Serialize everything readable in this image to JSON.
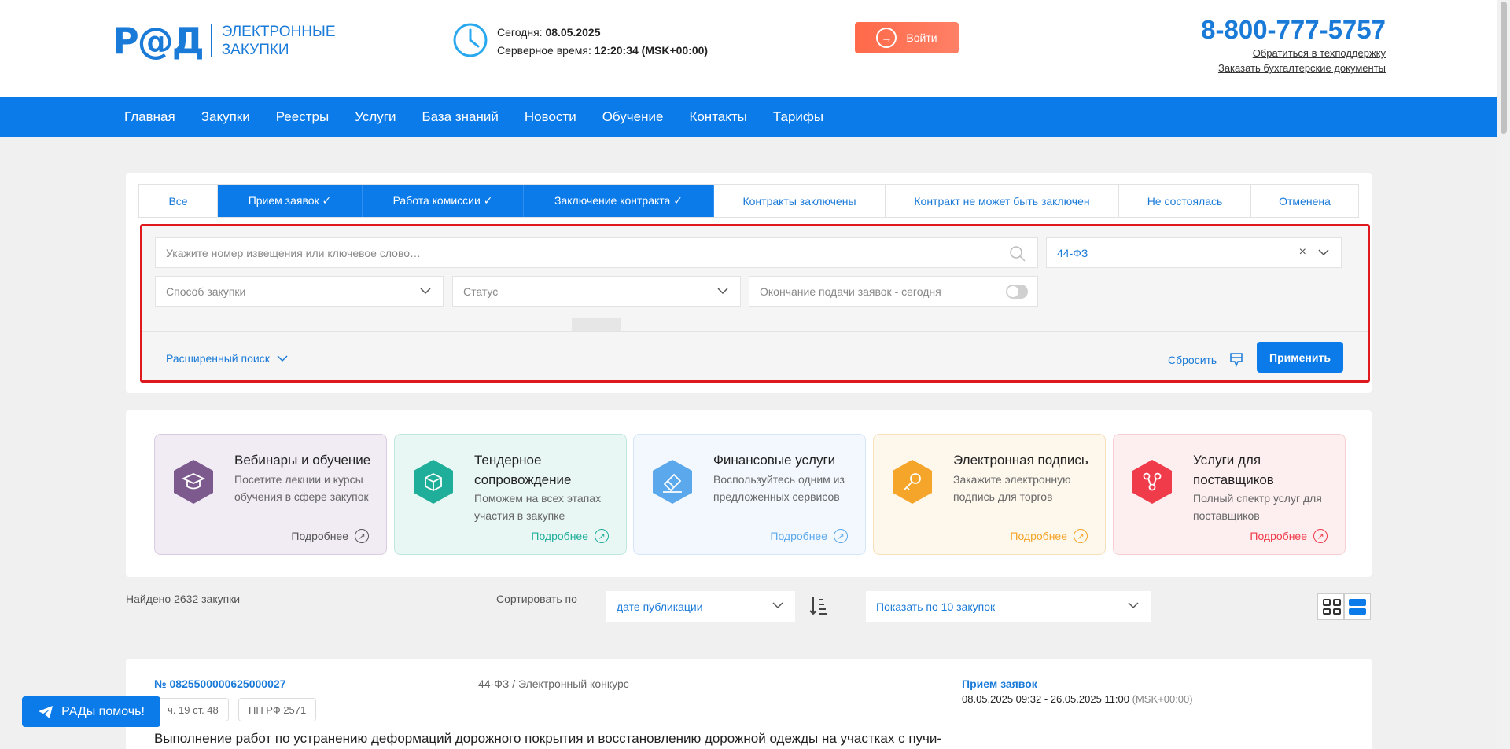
{
  "header": {
    "logo_mark": "Р@Д",
    "logo_line1": "ЭЛЕКТРОННЫЕ",
    "logo_line2": "ЗАКУПКИ",
    "today_label": "Сегодня: ",
    "today_value": "08.05.2025",
    "server_label": "Серверное время: ",
    "server_value": "12:20:34 (MSK+00:00)",
    "login_label": "Войти",
    "phone": "8-800-777-5757",
    "support_link": "Обратиться в техподдержку",
    "docs_link": "Заказать бухгалтерские документы"
  },
  "nav": {
    "items": [
      "Главная",
      "Закупки",
      "Реестры",
      "Услуги",
      "База знаний",
      "Новости",
      "Обучение",
      "Контакты",
      "Тарифы"
    ]
  },
  "tabs": [
    {
      "label": "Все",
      "active": false
    },
    {
      "label": "Прием заявок ✓",
      "active": true
    },
    {
      "label": "Работа комиссии ✓",
      "active": true
    },
    {
      "label": "Заключение контракта ✓",
      "active": true
    },
    {
      "label": "Контракты заключены",
      "active": false
    },
    {
      "label": "Контракт не может быть заключен",
      "active": false
    },
    {
      "label": "Не состоялась",
      "active": false
    },
    {
      "label": "Отменена",
      "active": false
    }
  ],
  "filters": {
    "search_placeholder": "Укажите номер извещения или ключевое слово…",
    "law_value": "44-ФЗ",
    "method_placeholder": "Способ закупки",
    "status_placeholder": "Статус",
    "deadline_toggle_label": "Окончание подачи заявок - сегодня",
    "deadline_toggle_on": false,
    "advanced_label": "Расширенный поиск",
    "reset_label": "Сбросить",
    "apply_label": "Применить"
  },
  "services": [
    {
      "title": "Вебинары и обучение",
      "desc": "Посетите лекции и курсы обучения в сфере закупок",
      "more": "Подробнее",
      "color": "#7d5a8e",
      "bg": "#f1ebf4",
      "border": "#d9cce0",
      "icon": "graduation-cap-icon"
    },
    {
      "title": "Тендерное сопровождение",
      "desc": "Поможем на всех этапах участия в закупке",
      "more": "Подробнее",
      "color": "#1fae9a",
      "bg": "#e9f7f4",
      "border": "#bfe6df",
      "icon": "cube-icon"
    },
    {
      "title": "Финансовые услуги",
      "desc": "Воспользуйтесь одним из предложенных сервисов",
      "more": "Подробнее",
      "color": "#5ba8ec",
      "bg": "#f3f8fe",
      "border": "#d5e6f8",
      "icon": "card-icon"
    },
    {
      "title": "Электронная подпись",
      "desc": "Закажите электронную подпись для торгов",
      "more": "Подробнее",
      "color": "#f4a52a",
      "bg": "#fef7ec",
      "border": "#f6e0bc",
      "icon": "key-icon"
    },
    {
      "title": "Услуги для поставщиков",
      "desc": "Полный спектр услуг для поставщиков",
      "more": "Подробнее",
      "color": "#ef3b4a",
      "bg": "#fdeff0",
      "border": "#f6cfd3",
      "icon": "network-icon"
    }
  ],
  "results": {
    "found_label": "Найдено 2632 закупки",
    "sort_label": "Сортировать по",
    "sort_value": "дате публикации",
    "per_page_value": "Показать по 10 закупок"
  },
  "tender": {
    "number": "№ 0825500000625000027",
    "law": "44-ФЗ / Электронный конкурс",
    "status": "Прием заявок",
    "dates": "08.05.2025 09:32 - 26.05.2025 11:00",
    "tz": "(MSK+00:00)",
    "badges": [
      "ч. 19 ст. 48",
      "ПП РФ 2571"
    ],
    "title": "Выполнение работ по устранению деформаций дорожного покрытия и восстановлению дорожной одежды на участках с пучи-"
  },
  "help_label": "РАДы помочь!"
}
